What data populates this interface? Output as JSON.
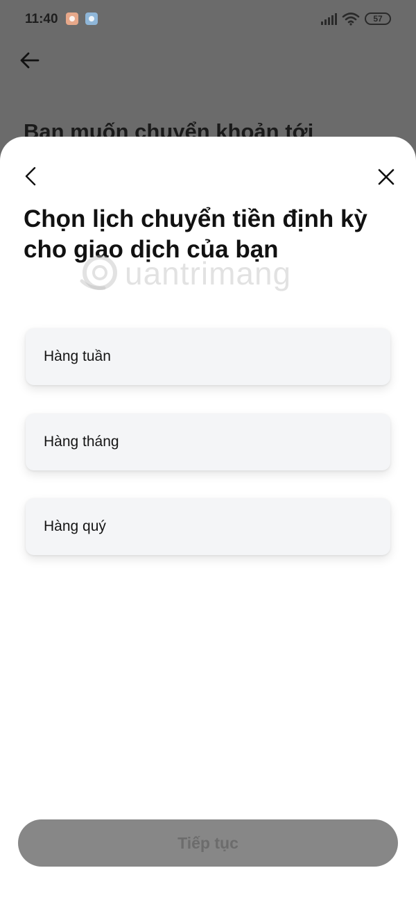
{
  "status_bar": {
    "time": "11:40",
    "battery_level": "57",
    "icons": [
      "notification-app-icon",
      "notification-app-icon",
      "signal-icon",
      "wifi-icon",
      "battery-icon"
    ]
  },
  "background_page": {
    "title": "Bạn muốn chuyển khoản tới"
  },
  "sheet": {
    "title": "Chọn lịch chuyển tiền định kỳ cho giao dịch của bạn",
    "watermark": "uantrimang",
    "options": [
      {
        "label": "Hàng tuần"
      },
      {
        "label": "Hàng tháng"
      },
      {
        "label": "Hàng quý"
      }
    ],
    "continue_label": "Tiếp tục"
  },
  "colors": {
    "overlay": "#6b6b6b",
    "sheet_background": "#ffffff",
    "option_background": "#f4f5f7",
    "button_disabled": "#878787"
  }
}
